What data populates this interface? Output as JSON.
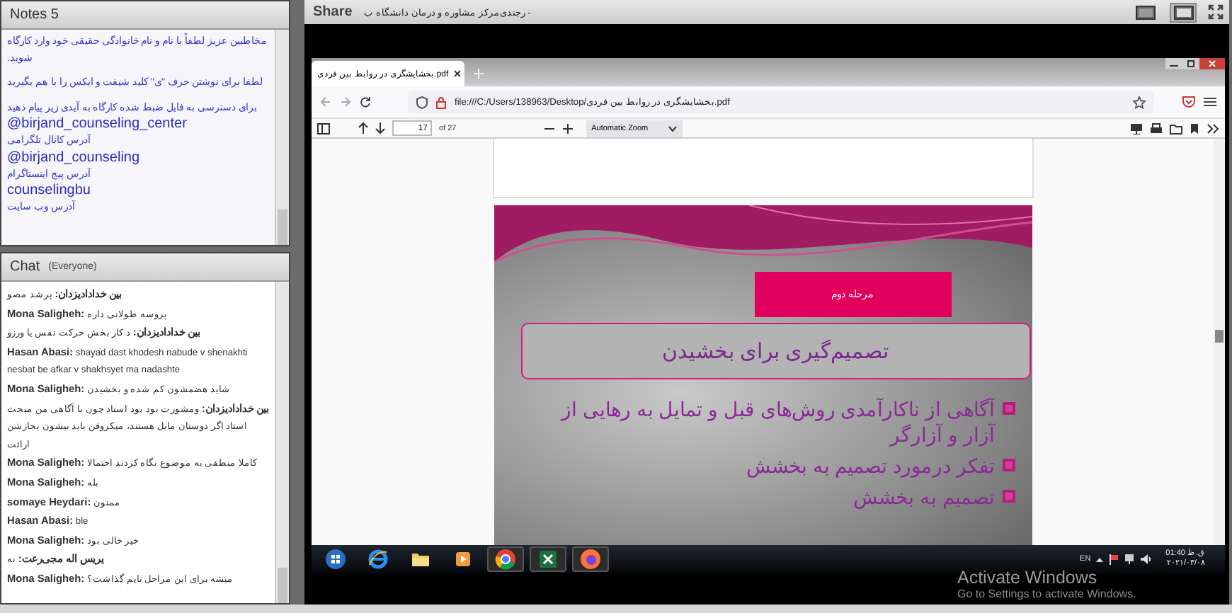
{
  "notes": {
    "title": "Notes 5",
    "paragraphs": [
      {
        "lines": [
          {
            "kind": "persian",
            "text": "مخاطبین عزیز لطفاً با نام و نام خانوادگی حقیقی خود وارد کارگاه شوید."
          }
        ]
      },
      {
        "lines": [
          {
            "kind": "persian",
            "text": "لطفا برای نوشتن حرف \"ی\" کلید شیفت و ایکس را با هم بگیرید"
          }
        ]
      },
      {
        "lines": [
          {
            "kind": "persian",
            "text": "برای دسترسی به فایل ضبط شده کارگاه به آیدی زیر پیام دهید"
          },
          {
            "kind": "handle",
            "text": "@birjand_counseling_center"
          },
          {
            "kind": "persian",
            "text": "آدرس کانال تلگرامی"
          },
          {
            "kind": "handle",
            "text": "@birjand_counseling"
          },
          {
            "kind": "persian",
            "text": "آدرس پیج اینستاگرام"
          },
          {
            "kind": "handle",
            "text": "counselingbu"
          },
          {
            "kind": "persian",
            "text": "آدرس وب سایت"
          }
        ]
      }
    ]
  },
  "chat": {
    "title": "Chat",
    "audience": "(Everyone)",
    "messages": [
      {
        "sender": "بین خدادادیزدان:",
        "text": "پرشد مصو"
      },
      {
        "sender": "Mona Saligheh:",
        "text": "پروسه طولانی داره"
      },
      {
        "sender": "بین خدادادیزدان:",
        "text": "د کار بخش حرکت نفس یا ورزو"
      },
      {
        "sender": "Hasan Abasi:",
        "text": "shayad dast khodesh nabude v shenakhti nesbat be afkar v shakhsyet ma nadashte"
      },
      {
        "sender": "Mona Saligheh:",
        "text": "شاید هضمشون کم شده و بخشیدن"
      },
      {
        "sender": "بین خدادادیزدان:",
        "text": "ومشورت بود بود استاد چون با آگاهی من مبحث"
      },
      {
        "text": "استاد اگر دوستان مایل هستند، میکروفن باید بیشون بجازشن ارائت"
      },
      {
        "sender": "Mona Saligheh:",
        "text": "کاملا منطقی به موضوع نگاه کردند احتمالا"
      },
      {
        "sender": "Mona Saligheh:",
        "text": "بله"
      },
      {
        "sender": "somaye Heydari:",
        "text": "ممنون"
      },
      {
        "sender": "Hasan Abasi:",
        "text": "ble"
      },
      {
        "sender": "Mona Saligheh:",
        "text": "خیر خالی بود"
      },
      {
        "sender": "یریس اله مجی‌رعت:",
        "text": "نه"
      },
      {
        "sender": "Mona Saligheh:",
        "text": "میشه برای این مراحل تایم گذاشت؟"
      }
    ]
  },
  "share": {
    "title": "Share",
    "subtitle": "رجندی‌مرکز مشاوره و درمان دانشگاه ب -",
    "layout_buttons": [
      {
        "selected": false
      },
      {
        "selected": true
      }
    ]
  },
  "browser": {
    "tab_title": "بخشایشگری در روابط بین فردی.pdf",
    "url": "file:///C:/Users/138963/Desktop/بخشایشگری در روابط بین فردی.pdf",
    "page": "17",
    "page_count": "of 27",
    "zoom": "Automatic Zoom"
  },
  "slide": {
    "label": "مرحله دوم",
    "title": "تصمیم‌گیری برای بخشیدن",
    "bullets": [
      "آگاهی از ناکارآمدی روش‌های قبل و تمایل به رهایی از آزار و آزارگر",
      "تفکر درمورد تصمیم به بخشش",
      "تصمیم به بخشش"
    ]
  },
  "taskbar": {
    "apps": [
      {
        "kind": "start",
        "running": false
      },
      {
        "kind": "ie",
        "running": false
      },
      {
        "kind": "folder",
        "running": false
      },
      {
        "kind": "media",
        "running": false
      },
      {
        "kind": "chrome",
        "running": true
      },
      {
        "kind": "excel",
        "running": true
      },
      {
        "kind": "firefox",
        "running": true
      }
    ],
    "language": "EN",
    "time": "ق.ظ 01:40",
    "date": "۲۰۲۱/۰۳/۰۸"
  },
  "activation": {
    "title": "Activate Windows",
    "subtitle": "Go to Settings to activate Windows."
  }
}
